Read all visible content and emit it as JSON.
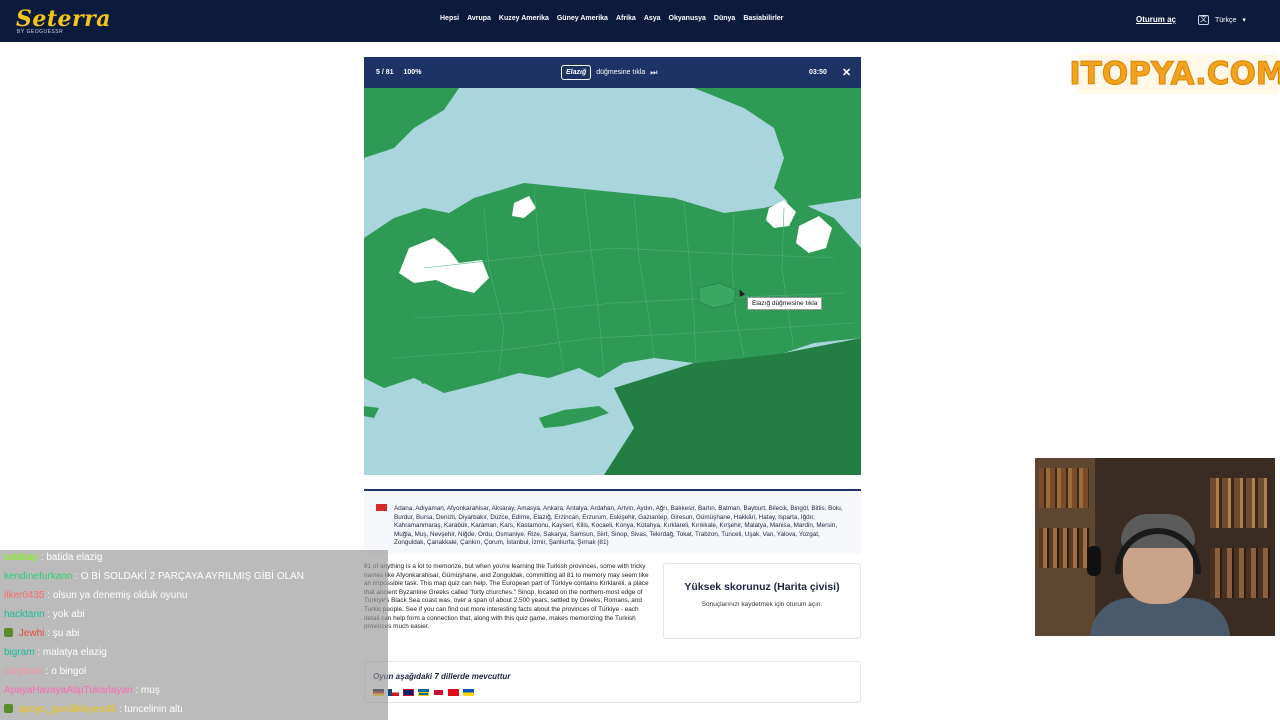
{
  "header": {
    "logo": "Seterra",
    "logo_sub": "BY GEOGUESSR",
    "nav": [
      "Hepsi",
      "Avrupa",
      "Kuzey Amerika",
      "Güney Amerika",
      "Afrika",
      "Asya",
      "Okyanusya",
      "Dünya",
      "Basiabilirler"
    ],
    "login": "Oturum aç",
    "language": "Türkçe"
  },
  "watermark": "ITOPYA.COM",
  "quiz": {
    "progress": "5 / 81",
    "percent": "100%",
    "target": "Elazığ",
    "prompt": "düğmesine tıkla",
    "timer": "03:50",
    "tooltip": "Elazığ düğmesine tıkla"
  },
  "provinces": {
    "text": "Adana, Adıyaman, Afyonkarahisar, Aksaray, Amasya, Ankara, Antalya, Ardahan, Artvin, Aydın, Ağrı, Balıkesir, Bartın, Batman, Bayburt, Bilecik, Bingöl, Bitlis, Bolu, Burdur, Bursa, Denizli, Diyarbakır, Düzce, Edirne, Elazığ, Erzincan, Erzurum, Eskişehir, Gaziantep, Giresun, Gümüşhane, Hakkâri, Hatay, Isparta, Iğdır, Kahramanmaraş, Karabük, Karaman, Kars, Kastamonu, Kayseri, Kilis, Kocaeli, Konya, Kütahya, Kırklareli, Kırıkkale, Kırşehir, Malatya, Manisa, Mardin, Mersin, Muğla, Muş, Nevşehir, Niğde, Ordu, Osmaniye, Rize, Sakarya, Samsun, Siirt, Sinop, Sivas, Tekirdağ, Tokat, Trabzon, Tunceli, Uşak, Van, Yalova, Yozgat, Zonguldak, Çanakkale, Çankırı, Çorum, İstanbul, İzmir, Şanlıurfa, Şırnak (81)"
  },
  "description": "81 of anything is a lot to memorize, but when you're learning the Turkish provinces, some with tricky names like Afyonkarahisar, Gümüşhane, and Zonguldak, committing all 81 to memory may seem like an impossible task. This map quiz can help. The European part of Türkiye contains Kırklareli, a place that ancient Byzantine Greeks called \"forty churches.\" Sinop, located on the northern-most edge of Türkiye's Black Sea coast was, over a span of about 2,500 years, settled by Greeks, Romans, and Turkic people. See if you can find out more interesting facts about the provinces of Türkiye - each detail can help form a connection that, along with this quiz game, makes memorizing the Turkish provinces much easier.",
  "score": {
    "title": "Yüksek skorunuz (Harita çivisi)",
    "subtitle": "Sonuçlarınızı kaydetmek için oturum açın."
  },
  "languages": {
    "title": "Oyun aşağıdaki 7 dillerde mevcuttur"
  },
  "colors": {
    "sea": "#a9d6dd",
    "land": "#2f9a55",
    "neighbor": "#237e44",
    "found": "#ffffff",
    "header": "#1d3366"
  },
  "chat": [
    {
      "user": "solakay",
      "msg": ": batida elazig",
      "color": "#7cfc00",
      "badge": ""
    },
    {
      "user": "kendinefurkann",
      "msg": ": O Bİ SOLDAKİ 2 PARÇAYA AYRILMIŞ GİBİ OLAN",
      "color": "#2ecc71",
      "badge": ""
    },
    {
      "user": "ilker0435",
      "msg": ": olsun ya denemiş olduk oyunu",
      "color": "#ff6b6b",
      "badge": ""
    },
    {
      "user": "hacktann",
      "msg": ": yok abi",
      "color": "#1abc9c",
      "badge": ""
    },
    {
      "user": "Jewhi",
      "msg": ": şu abi",
      "color": "#e74c3c",
      "badge": "#5b8c2a"
    },
    {
      "user": "bigram",
      "msg": ": malatya elazig",
      "color": "#1abc9c",
      "badge": ""
    },
    {
      "user": "curyborn",
      "msg": ": o bingol",
      "color": "#ff8da1",
      "badge": ""
    },
    {
      "user": "ApayaHavayaAtipTukarlayan",
      "msg": ": muş",
      "color": "#ff69b4",
      "badge": ""
    },
    {
      "user": "apoyu_gondikleyen45",
      "msg": ": tuncelinin altı",
      "color": "#f1c40f",
      "badge": "#5b8c2a"
    }
  ]
}
